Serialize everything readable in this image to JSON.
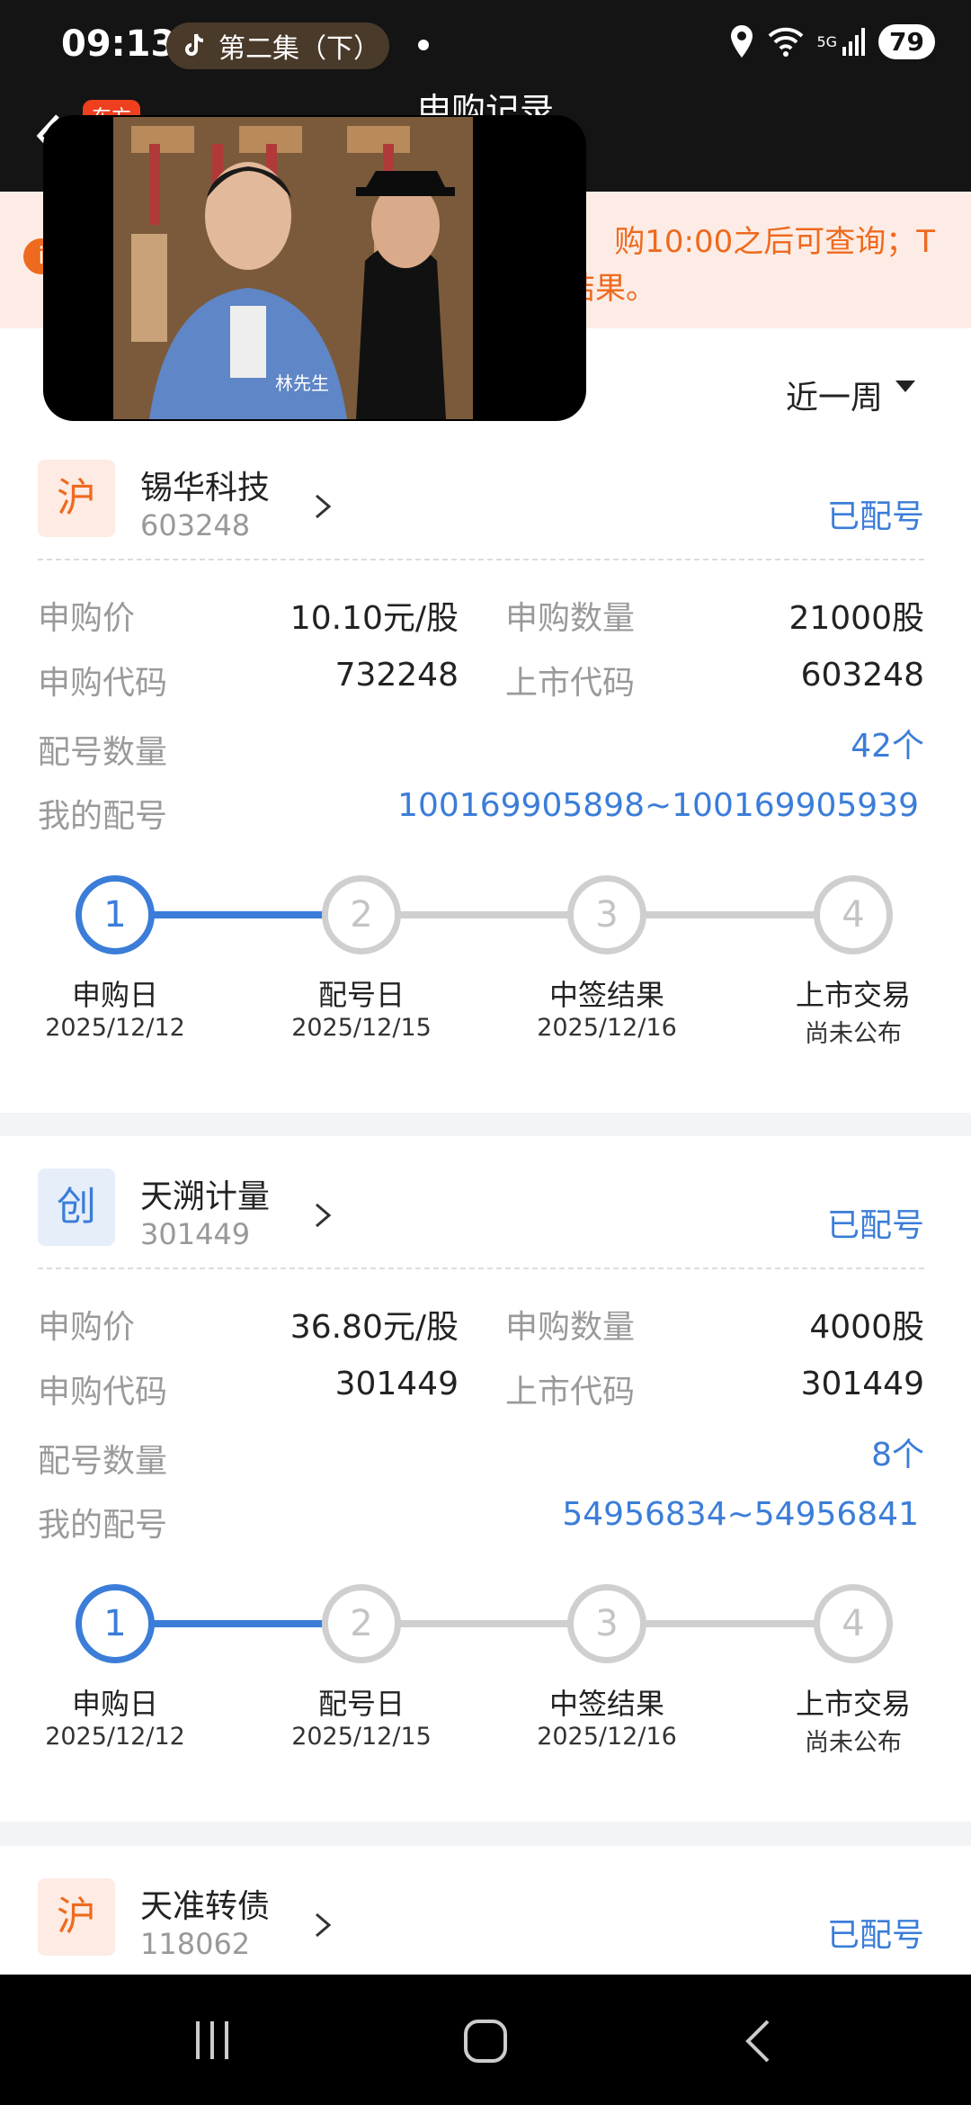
{
  "status_bar": {
    "time": "09:13",
    "tiktok_label": "第二集（下）",
    "network": "5G",
    "battery": "79"
  },
  "header": {
    "title": "申购记录",
    "badge": "东方"
  },
  "notice": {
    "line1": "购10:00之后可查询；T",
    "line2": "签结果。"
  },
  "filter": {
    "period": "近一周"
  },
  "labels": {
    "price": "申购价",
    "quantity": "申购数量",
    "sub_code": "申购代码",
    "list_code": "上市代码",
    "alloc_count": "配号数量",
    "my_alloc": "我的配号"
  },
  "step_labels": [
    "申购日",
    "配号日",
    "中签结果",
    "上市交易"
  ],
  "cards": [
    {
      "market": "沪",
      "name": "锡华科技",
      "code": "603248",
      "status": "已配号",
      "price": "10.10元/股",
      "quantity": "21000股",
      "sub_code": "732248",
      "list_code": "603248",
      "alloc_count": "42个",
      "my_alloc": "100169905898~100169905939",
      "step_dates": [
        "2025/12/12",
        "2025/12/15",
        "2025/12/16",
        "尚未公布"
      ],
      "active_step": 1
    },
    {
      "market": "创",
      "name": "天溯计量",
      "code": "301449",
      "status": "已配号",
      "price": "36.80元/股",
      "quantity": "4000股",
      "sub_code": "301449",
      "list_code": "301449",
      "alloc_count": "8个",
      "my_alloc": "54956834~54956841",
      "step_dates": [
        "2025/12/12",
        "2025/12/15",
        "2025/12/16",
        "尚未公布"
      ],
      "active_step": 1
    },
    {
      "market": "沪",
      "name": "天准转债",
      "code": "118062",
      "status": "已配号"
    }
  ],
  "video": {
    "caption": "林先生"
  },
  "colors": {
    "accent_blue": "#3b7dd8",
    "warning_orange": "#ee6a1e",
    "step_inactive": "#cfcfcf"
  }
}
